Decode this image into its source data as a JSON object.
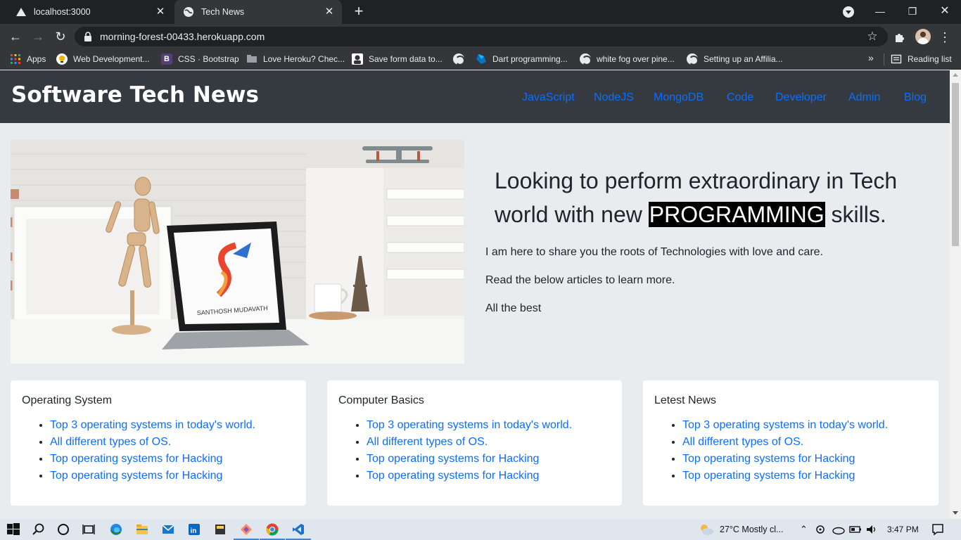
{
  "browser": {
    "tabs": [
      {
        "title": "localhost:3000",
        "icon": "triangle-favicon-icon"
      },
      {
        "title": "Tech News",
        "icon": "globe-icon",
        "active": true
      }
    ],
    "url": "morning-forest-00433.herokuapp.com",
    "bookmarks": [
      {
        "label": "Apps",
        "icon": "apps-grid-icon"
      },
      {
        "label": "Web Development...",
        "icon": "bulb-icon"
      },
      {
        "label": "CSS · Bootstrap",
        "icon": "bootstrap-icon"
      },
      {
        "label": "Love Heroku? Chec...",
        "icon": "folder-icon"
      },
      {
        "label": "Save form data to...",
        "icon": "avatar-icon"
      },
      {
        "label": "",
        "icon": "globe-icon"
      },
      {
        "label": "Dart programming...",
        "icon": "dart-icon"
      },
      {
        "label": "white fog over pine...",
        "icon": "globe-icon"
      },
      {
        "label": "Setting up an Affilia...",
        "icon": "globe-icon"
      }
    ],
    "more_bookmarks": "»",
    "reading_list": "Reading list",
    "colors": {
      "tabbar": "#202124",
      "toolbar": "#35363a"
    }
  },
  "site": {
    "brand": "Software Tech News",
    "nav": [
      "JavaScript",
      "NodeJS",
      "MongoDB",
      "Code",
      "Developer",
      "Admin",
      "Blog"
    ],
    "hero": {
      "title_before": "Looking to perform extraordinary in Tech world with new ",
      "title_highlight": "PROGRAMMING",
      "title_after": " skills.",
      "paragraphs": [
        "I am here to share you the roots of Technologies with love and care.",
        "Read the below articles to learn more.",
        "All the best"
      ],
      "image_caption": "SANTHOSH MUDAVATH"
    },
    "cards": [
      {
        "title": "Operating System",
        "links": [
          "Top 3 operating systems in today's world.",
          "All different types of OS.",
          "Top operating systems for Hacking",
          "Top operating systems for Hacking"
        ]
      },
      {
        "title": "Computer Basics",
        "links": [
          "Top 3 operating systems in today's world.",
          "All different types of OS.",
          "Top operating systems for Hacking",
          "Top operating systems for Hacking"
        ]
      },
      {
        "title": "Letest News",
        "links": [
          "Top 3 operating systems in today's world.",
          "All different types of OS.",
          "Top operating systems for Hacking",
          "Top operating systems for Hacking"
        ]
      }
    ],
    "colors": {
      "navbar": "#343a40",
      "link": "#0d6efd",
      "background": "#e9ecef"
    }
  },
  "taskbar": {
    "weather": "27°C  Mostly cl...",
    "time": "3:47 PM"
  }
}
